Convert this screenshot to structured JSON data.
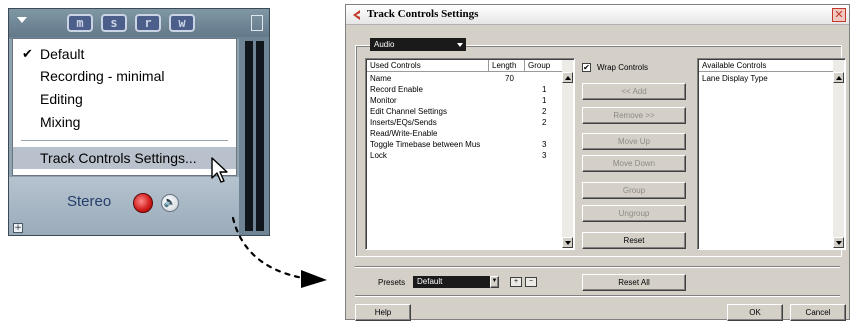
{
  "track": {
    "buttons": [
      "m",
      "s",
      "r",
      "w"
    ],
    "stereo_label": "Stereo"
  },
  "context_menu": {
    "items": [
      {
        "label": "Default",
        "checked": true
      },
      {
        "label": "Recording - minimal",
        "checked": false
      },
      {
        "label": "Editing",
        "checked": false
      },
      {
        "label": "Mixing",
        "checked": false
      },
      {
        "label": "Track Controls Settings...",
        "highlighted": true
      }
    ]
  },
  "dialog": {
    "title": "Track Controls Settings",
    "track_type": "Audio",
    "used_controls": {
      "headers": [
        "Used Controls",
        "Length",
        "Group"
      ],
      "rows": [
        {
          "name": "Name",
          "length": "70",
          "group": ""
        },
        {
          "name": "Record Enable",
          "length": "",
          "group": "1"
        },
        {
          "name": "Monitor",
          "length": "",
          "group": "1"
        },
        {
          "name": "Edit Channel Settings",
          "length": "",
          "group": "2"
        },
        {
          "name": "Inserts/EQs/Sends",
          "length": "",
          "group": "2"
        },
        {
          "name": "Read/Write-Enable",
          "length": "",
          "group": ""
        },
        {
          "name": "Toggle Timebase between Mus",
          "length": "",
          "group": "3"
        },
        {
          "name": "Lock",
          "length": "",
          "group": "3"
        }
      ]
    },
    "wrap_controls": {
      "label": "Wrap Controls",
      "checked": true
    },
    "buttons": {
      "add": "<< Add",
      "remove": "Remove >>",
      "move_up": "Move Up",
      "move_down": "Move Down",
      "group": "Group",
      "ungroup": "Ungroup",
      "reset": "Reset",
      "reset_all": "Reset All",
      "help": "Help",
      "ok": "OK",
      "cancel": "Cancel"
    },
    "available_controls": {
      "header": "Available Controls",
      "items": [
        "Lane Display Type"
      ]
    },
    "presets": {
      "label": "Presets",
      "value": "Default"
    }
  },
  "colors": {
    "track_bg": "#6f8494",
    "menu_highlight": "#b9c2cc",
    "dialog_bg": "#d4d0c8",
    "record_red": "#d01818",
    "brand_red": "#c0392b"
  }
}
